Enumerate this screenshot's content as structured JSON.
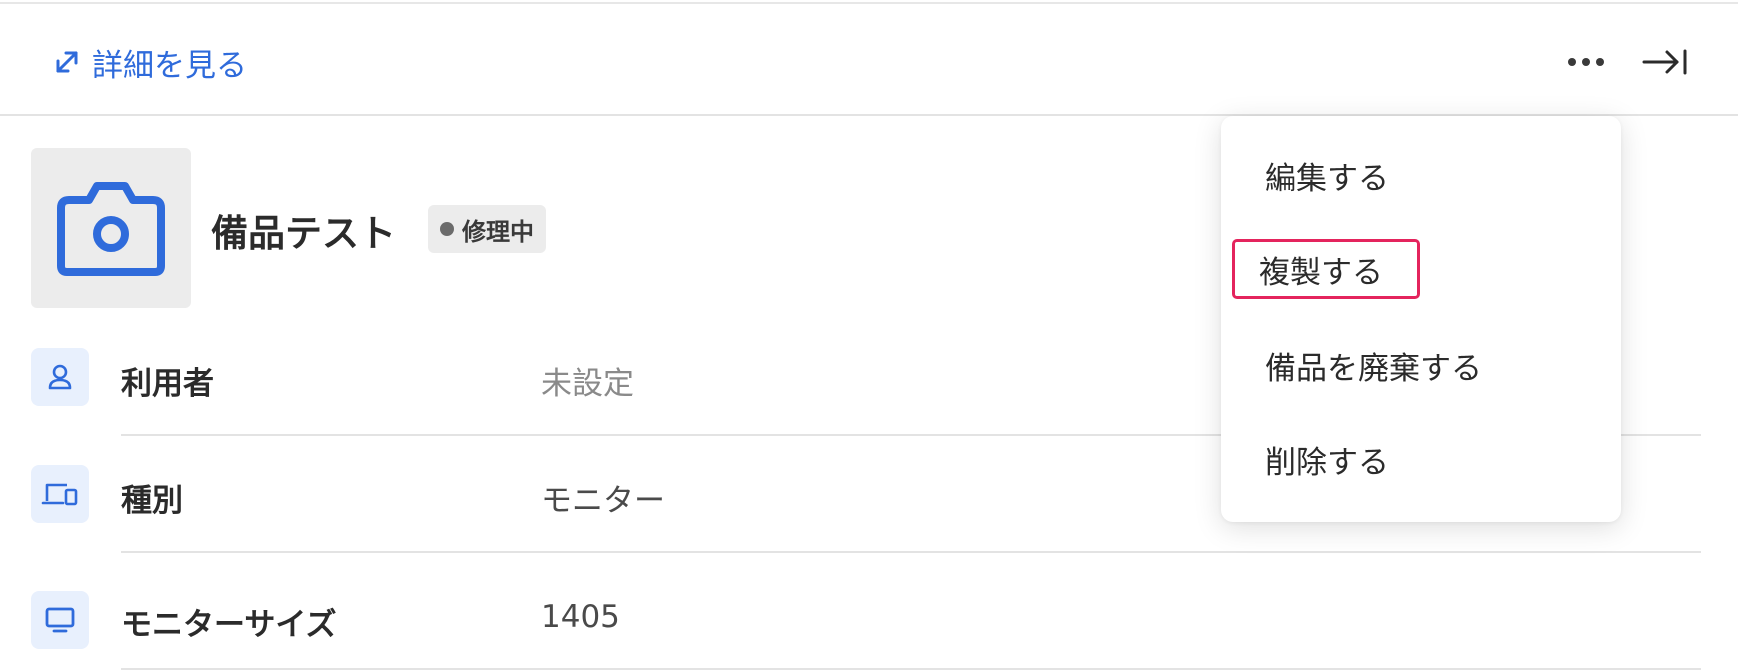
{
  "header": {
    "detail_link_label": "詳細を見る"
  },
  "item": {
    "name": "備品テスト",
    "status": "修理中"
  },
  "rows": [
    {
      "label": "利用者",
      "value": "未設定",
      "icon": "user-icon"
    },
    {
      "label": "種別",
      "value": "モニター",
      "icon": "devices-icon"
    },
    {
      "label": "モニターサイズ",
      "value": "1405",
      "icon": "monitor-icon"
    }
  ],
  "menu": {
    "items": [
      {
        "label": "編集する"
      },
      {
        "label": "複製する"
      },
      {
        "label": "備品を廃棄する"
      },
      {
        "label": "削除する"
      }
    ]
  },
  "colors": {
    "accent": "#2f6bdb",
    "highlight": "#e4245d",
    "icon_bg": "#e8f0fd",
    "badge_bg": "#ececec"
  }
}
